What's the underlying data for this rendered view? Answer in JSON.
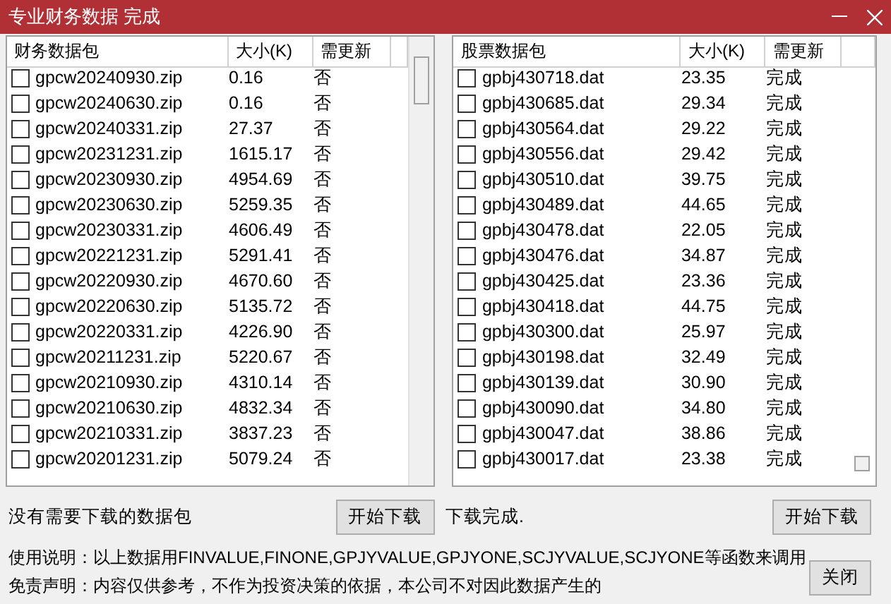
{
  "window": {
    "title": "专业财务数据 完成"
  },
  "finance_list": {
    "columns": [
      "财务数据包",
      "大小(K)",
      "需更新"
    ],
    "rows": [
      {
        "name": "gpcw20240930.zip",
        "size": "0.16",
        "update": "否",
        "checked": false
      },
      {
        "name": "gpcw20240630.zip",
        "size": "0.16",
        "update": "否",
        "checked": false
      },
      {
        "name": "gpcw20240331.zip",
        "size": "27.37",
        "update": "否",
        "checked": false
      },
      {
        "name": "gpcw20231231.zip",
        "size": "1615.17",
        "update": "否",
        "checked": false
      },
      {
        "name": "gpcw20230930.zip",
        "size": "4954.69",
        "update": "否",
        "checked": false
      },
      {
        "name": "gpcw20230630.zip",
        "size": "5259.35",
        "update": "否",
        "checked": false
      },
      {
        "name": "gpcw20230331.zip",
        "size": "4606.49",
        "update": "否",
        "checked": false
      },
      {
        "name": "gpcw20221231.zip",
        "size": "5291.41",
        "update": "否",
        "checked": false
      },
      {
        "name": "gpcw20220930.zip",
        "size": "4670.60",
        "update": "否",
        "checked": false
      },
      {
        "name": "gpcw20220630.zip",
        "size": "5135.72",
        "update": "否",
        "checked": false
      },
      {
        "name": "gpcw20220331.zip",
        "size": "4226.90",
        "update": "否",
        "checked": false
      },
      {
        "name": "gpcw20211231.zip",
        "size": "5220.67",
        "update": "否",
        "checked": false
      },
      {
        "name": "gpcw20210930.zip",
        "size": "4310.14",
        "update": "否",
        "checked": false
      },
      {
        "name": "gpcw20210630.zip",
        "size": "4832.34",
        "update": "否",
        "checked": false
      },
      {
        "name": "gpcw20210331.zip",
        "size": "3837.23",
        "update": "否",
        "checked": false
      },
      {
        "name": "gpcw20201231.zip",
        "size": "5079.24",
        "update": "否",
        "checked": false
      }
    ]
  },
  "stock_list": {
    "columns": [
      "股票数据包",
      "大小(K)",
      "需更新"
    ],
    "rows": [
      {
        "name": "gpbj430718.dat",
        "size": "23.35",
        "update": "完成",
        "checked": false
      },
      {
        "name": "gpbj430685.dat",
        "size": "29.34",
        "update": "完成",
        "checked": false
      },
      {
        "name": "gpbj430564.dat",
        "size": "29.22",
        "update": "完成",
        "checked": false
      },
      {
        "name": "gpbj430556.dat",
        "size": "29.42",
        "update": "完成",
        "checked": false
      },
      {
        "name": "gpbj430510.dat",
        "size": "39.75",
        "update": "完成",
        "checked": false
      },
      {
        "name": "gpbj430489.dat",
        "size": "44.65",
        "update": "完成",
        "checked": false
      },
      {
        "name": "gpbj430478.dat",
        "size": "22.05",
        "update": "完成",
        "checked": false
      },
      {
        "name": "gpbj430476.dat",
        "size": "34.87",
        "update": "完成",
        "checked": false
      },
      {
        "name": "gpbj430425.dat",
        "size": "23.36",
        "update": "完成",
        "checked": false
      },
      {
        "name": "gpbj430418.dat",
        "size": "44.75",
        "update": "完成",
        "checked": false
      },
      {
        "name": "gpbj430300.dat",
        "size": "25.97",
        "update": "完成",
        "checked": false
      },
      {
        "name": "gpbj430198.dat",
        "size": "32.49",
        "update": "完成",
        "checked": false
      },
      {
        "name": "gpbj430139.dat",
        "size": "30.90",
        "update": "完成",
        "checked": false
      },
      {
        "name": "gpbj430090.dat",
        "size": "34.80",
        "update": "完成",
        "checked": false
      },
      {
        "name": "gpbj430047.dat",
        "size": "38.86",
        "update": "完成",
        "checked": false
      },
      {
        "name": "gpbj430017.dat",
        "size": "23.38",
        "update": "完成",
        "checked": false
      }
    ]
  },
  "finance_status": "没有需要下载的数据包",
  "finance_button": "开始下载",
  "stock_status": "下载完成.",
  "stock_button": "开始下载",
  "notes": [
    "使用说明：以上数据用FINVALUE,FINONE,GPJYVALUE,GPJYONE,SCJYVALUE,SCJYONE等函数来调用",
    "免责声明：内容仅供参考，不作为投资决策的依据，本公司不对因此数据产生的"
  ],
  "close_button": "关闭"
}
